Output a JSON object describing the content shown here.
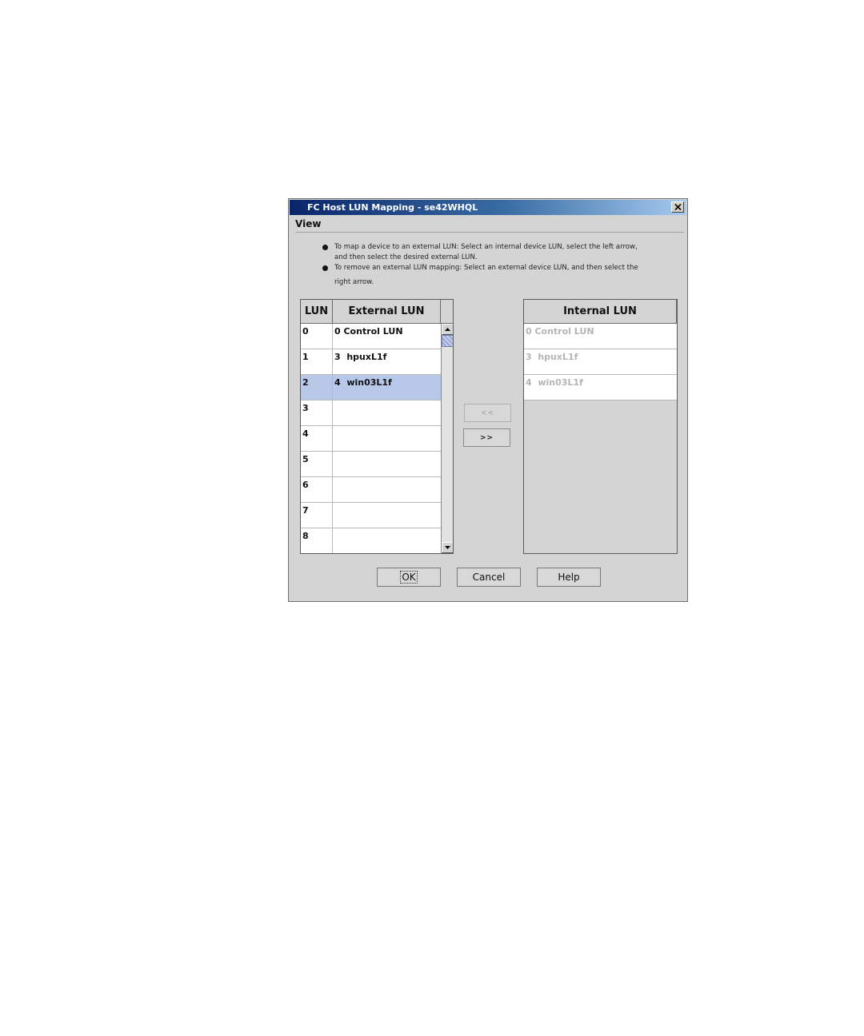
{
  "window": {
    "title": "FC Host LUN Mapping - se42WHQL",
    "close_icon": "close-icon"
  },
  "menu": {
    "view_label": "View"
  },
  "instructions": {
    "item1_line1": "To map a device to an external LUN: Select an internal device LUN, select the left arrow,",
    "item1_line2": "and then select the desired external LUN.",
    "item2_line1": "To remove an external LUN mapping: Select an external device LUN, and then select the",
    "item2_line2": "right arrow."
  },
  "external_table": {
    "headers": {
      "lun": "LUN",
      "external": "External LUN"
    },
    "rows": [
      {
        "lun": "0",
        "external": "0 Control LUN"
      },
      {
        "lun": "1",
        "external": "3  hpuxL1f"
      },
      {
        "lun": "2",
        "external": "4  win03L1f",
        "selected": true
      },
      {
        "lun": "3",
        "external": ""
      },
      {
        "lun": "4",
        "external": ""
      },
      {
        "lun": "5",
        "external": ""
      },
      {
        "lun": "6",
        "external": ""
      },
      {
        "lun": "7",
        "external": ""
      },
      {
        "lun": "8",
        "external": ""
      }
    ]
  },
  "arrows": {
    "left_label": "<<",
    "right_label": ">>"
  },
  "internal_table": {
    "header": "Internal LUN",
    "rows": [
      "0 Control LUN",
      "3  hpuxL1f",
      "4  win03L1f"
    ]
  },
  "buttons": {
    "ok": "OK",
    "cancel": "Cancel",
    "help": "Help"
  },
  "colors": {
    "title_start": "#0a246a",
    "selection": "#b8c8e8",
    "dialog_bg": "#d4d4d4"
  }
}
